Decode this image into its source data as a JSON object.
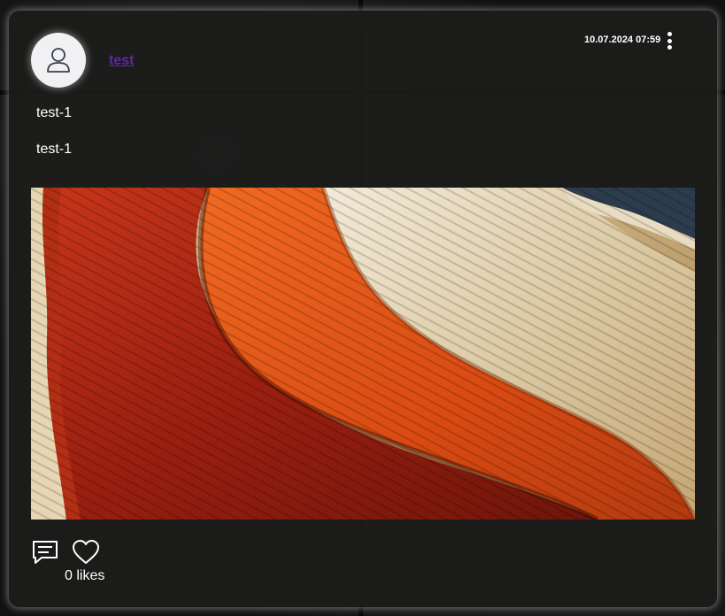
{
  "post": {
    "author": "test",
    "timestamp": "10.07.2024 07:59",
    "title": "test-1",
    "body": "test-1",
    "likes_label": "0 likes",
    "likes_count": 0
  },
  "icons": {
    "avatar": "user-avatar-icon",
    "menu": "more-vertical-icon",
    "comment": "comment-icon",
    "like": "heart-icon"
  },
  "colors": {
    "card_background": "#1c1c1b",
    "author_link": "#5a2ba0",
    "text": "#ffffff",
    "avatar_background": "#f1f1f3"
  }
}
